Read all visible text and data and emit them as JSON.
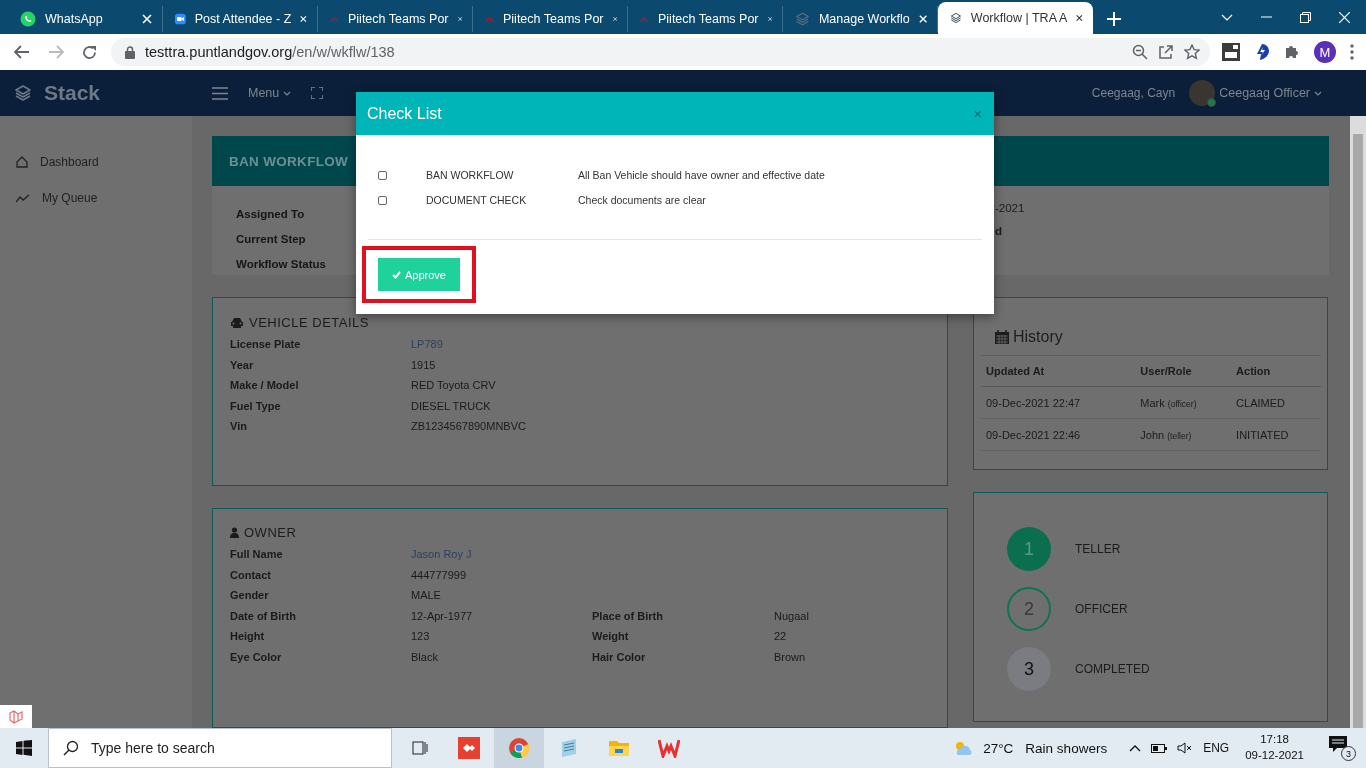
{
  "browser": {
    "tabs": [
      {
        "title": "WhatsApp",
        "selected": false
      },
      {
        "title": "Post Attendee - Z",
        "selected": false
      },
      {
        "title": "Piitech Teams Por",
        "selected": false
      },
      {
        "title": "Piitech Teams Por",
        "selected": false
      },
      {
        "title": "Piitech Teams Por",
        "selected": false
      },
      {
        "title": "Manage Workflo",
        "selected": false
      },
      {
        "title": "Workflow | TRA A",
        "selected": true
      }
    ],
    "url_host": "testtra.puntlandgov.org",
    "url_path": "/en/w/wkflw/138",
    "profile_initial": "M"
  },
  "app": {
    "brand": "Stack",
    "menu_label": "Menu",
    "user_name": "Ceegaag, Cayn",
    "user_role": "Ceegaag Officer"
  },
  "sidebar": {
    "items": [
      {
        "label": "Dashboard"
      },
      {
        "label": "My Queue"
      }
    ]
  },
  "workflow_card": {
    "title": "BAN WORKFLOW",
    "fields": [
      "Assigned To",
      "Current Step",
      "Workflow Status"
    ],
    "right_fragments": [
      {
        "text": "-2021",
        "bold": false
      },
      {
        "text": "d",
        "bold": true
      }
    ]
  },
  "vehicle": {
    "title": "VEHICLE DETAILS",
    "rows": [
      {
        "label": "License Plate",
        "value": "LP789",
        "link": true
      },
      {
        "label": "Year",
        "value": "1915",
        "link": false
      },
      {
        "label": "Make / Model",
        "value": "RED Toyota CRV",
        "link": false
      },
      {
        "label": "Fuel Type",
        "value": "DIESEL TRUCK",
        "link": false
      },
      {
        "label": "Vin",
        "value": "ZB1234567890MNBVC",
        "link": false
      }
    ]
  },
  "owner": {
    "title": "OWNER",
    "rows": [
      {
        "label": "Full Name",
        "value": "Jason Roy J",
        "link": true
      },
      {
        "label": "Contact",
        "value": "444777999",
        "link": false
      },
      {
        "label": "Gender",
        "value": "MALE",
        "link": false
      },
      {
        "label": "Date of Birth",
        "value": "12-Apr-1977",
        "link": false,
        "label_2": "Place of Birth",
        "value_2": "Nugaal"
      },
      {
        "label": "Height",
        "value": "123",
        "link": false,
        "label_2": "Weight",
        "value_2": "22"
      },
      {
        "label": "Eye Color",
        "value": "Black",
        "link": false,
        "label_2": "Hair Color",
        "value_2": "Brown"
      }
    ]
  },
  "history": {
    "title": "History",
    "columns": [
      "Updated At",
      "User/Role",
      "Action"
    ],
    "rows": [
      {
        "updated_at": "09-Dec-2021 22:47",
        "user": "Mark",
        "role": "(officer)",
        "action": "CLAIMED"
      },
      {
        "updated_at": "09-Dec-2021 22:46",
        "user": "John",
        "role": "(teller)",
        "action": "INITIATED"
      }
    ]
  },
  "steps": [
    {
      "number": "1",
      "label": "TELLER",
      "kind": "done"
    },
    {
      "number": "2",
      "label": "OFFICER",
      "kind": "current"
    },
    {
      "number": "3",
      "label": "COMPLETED",
      "kind": "pending"
    }
  ],
  "modal": {
    "title": "Check List",
    "close": "×",
    "items": [
      {
        "name": "BAN WORKFLOW",
        "description": "All Ban Vehicle should have owner and effective date",
        "checked": false
      },
      {
        "name": "DOCUMENT CHECK",
        "description": "Check documents are clear",
        "checked": false
      }
    ],
    "approve_label": "Approve",
    "approve_highlighted": true
  },
  "taskbar": {
    "search_placeholder": "Type here to search",
    "temperature": "27°C",
    "weather": "Rain showers",
    "language": "ENG",
    "time": "17:18",
    "date": "09-12-2021",
    "notifications": "3"
  }
}
